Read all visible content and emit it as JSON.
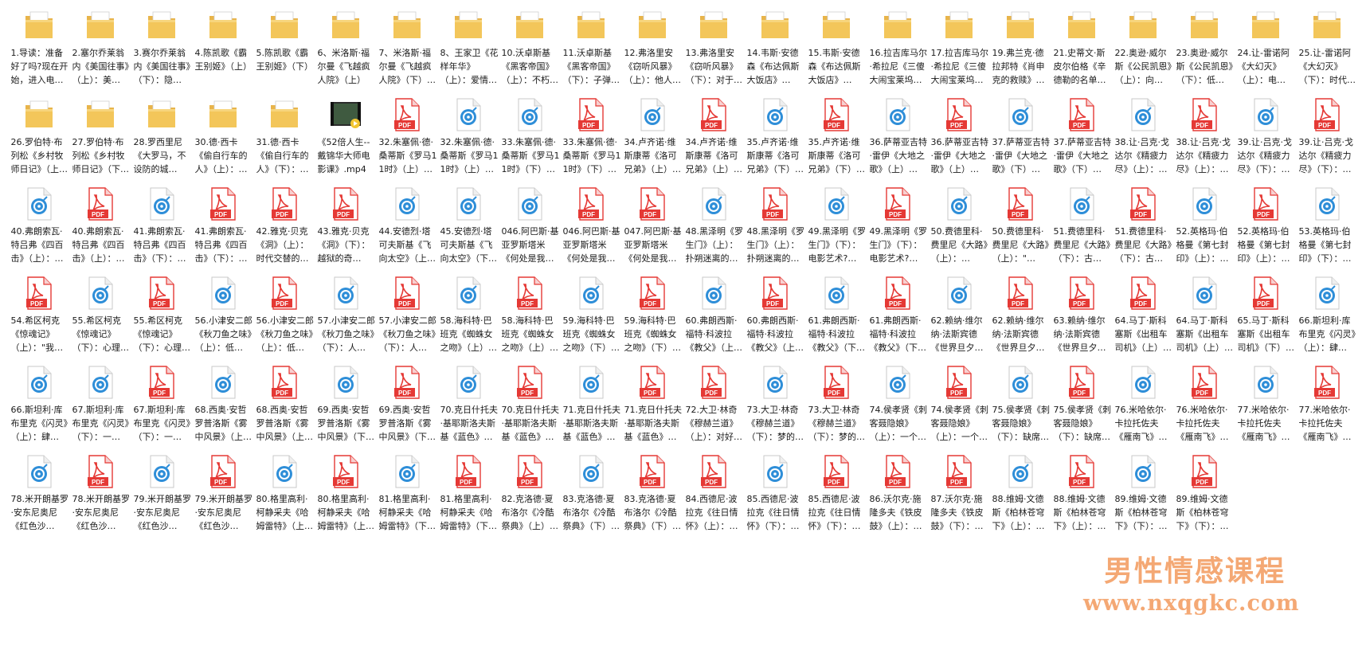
{
  "files": [
    {
      "type": "folder",
      "label": "1.导读：准备好了吗?现在开始，进入电影…"
    },
    {
      "type": "folder",
      "label": "2.塞尔乔莱翁内《美国往事》（上）：美…"
    },
    {
      "type": "folder",
      "label": "3.赛尔乔莱翁内《美国往事》（下）：隐…"
    },
    {
      "type": "folder",
      "label": "4.陈凯歌《霸王别姬》（上）"
    },
    {
      "type": "folder",
      "label": "5.陈凯歌《霸王别姬》（下）"
    },
    {
      "type": "folder",
      "label": "6、米洛斯·福尔曼《飞越疯人院》（上）"
    },
    {
      "type": "folder",
      "label": "7、米洛斯·福尔曼《飞越疯人院》（下）…"
    },
    {
      "type": "folder",
      "label": "8、王家卫《花样年华》（上）：爱情的…"
    },
    {
      "type": "folder",
      "label": "10.沃卓斯基《黑客帝国》（上）：不朽的…"
    },
    {
      "type": "folder",
      "label": "11.沃卓斯基《黑客帝国》（下）：子弹时间"
    },
    {
      "type": "folder",
      "label": "12.弗洛里安《窃听风暴》（上）：他人的…"
    },
    {
      "type": "folder",
      "label": "13.弗洛里安《窃听风暴》（下）：对于背…"
    },
    {
      "type": "folder",
      "label": "14.韦斯·安德森《布达佩斯大饭店》（上）…"
    },
    {
      "type": "folder",
      "label": "15.韦斯·安德森《布达佩斯大饭店》（下）…"
    },
    {
      "type": "folder",
      "label": "16.拉吉库马尔·希拉尼《三傻大闹宝莱坞…"
    },
    {
      "type": "folder",
      "label": "17.拉吉库马尔·希拉尼《三傻大闹宝莱坞…"
    },
    {
      "type": "folder",
      "label": "19.弗兰克·德拉邦特《肖申克的救赎》（下…"
    },
    {
      "type": "folder",
      "label": "21.史蒂文·斯皮尔伯格《辛德勒的名单》（…"
    },
    {
      "type": "folder",
      "label": "22.奥逊·威尔斯《公民凯恩》（上）：向…"
    },
    {
      "type": "folder",
      "label": "23.奥逊·威尔斯《公民凯恩》（下）：低…"
    },
    {
      "type": "folder",
      "label": "24.让-雷诺阿《大幻灭》（上）：电影，…"
    },
    {
      "type": "folder",
      "label": "25.让-雷诺阿《大幻灭》（下）：时代的…"
    },
    {
      "type": "folder",
      "label": "26.罗伯特·布列松《乡村牧师日记》（上…"
    },
    {
      "type": "folder",
      "label": "27.罗伯特·布列松《乡村牧师日记》（下…"
    },
    {
      "type": "folder",
      "label": "28.罗西里尼《大罗马，不设防的城市》…"
    },
    {
      "type": "folder",
      "label": "30.德·西卡《偷自行车的人》（上）：新…"
    },
    {
      "type": "folder",
      "label": "31.德·西卡《偷自行车的人》（下）：摄…"
    },
    {
      "type": "video",
      "label": "《52倍人生--戴锦华大师电影课》.mp4"
    },
    {
      "type": "pdf",
      "label": "32.朱塞佩·德·桑蒂斯《罗马11时》（上）…"
    },
    {
      "type": "audio",
      "label": "32.朱塞佩·德·桑蒂斯《罗马11时》（上）…"
    },
    {
      "type": "audio",
      "label": "33.朱塞佩·德·桑蒂斯《罗马11时》（下）…"
    },
    {
      "type": "pdf",
      "label": "33.朱塞佩·德·桑蒂斯《罗马11时》（下）…"
    },
    {
      "type": "audio",
      "label": "34.卢齐诺·维斯康蒂《洛可兄弟》（上）…"
    },
    {
      "type": "pdf",
      "label": "34.卢齐诺·维斯康蒂《洛可兄弟》（上）…"
    },
    {
      "type": "audio",
      "label": "35.卢齐诺·维斯康蒂《洛可兄弟》（下）…"
    },
    {
      "type": "pdf",
      "label": "35.卢齐诺·维斯康蒂《洛可兄弟》（下）…"
    },
    {
      "type": "audio",
      "label": "36.萨蒂亚吉特·雷伊《大地之歌》（上）…"
    },
    {
      "type": "pdf",
      "label": "36.萨蒂亚吉特·雷伊《大地之歌》（上）…"
    },
    {
      "type": "audio",
      "label": "37.萨蒂亚吉特·雷伊《大地之歌》（下）…"
    },
    {
      "type": "pdf",
      "label": "37.萨蒂亚吉特·雷伊《大地之歌》（下）…"
    },
    {
      "type": "audio",
      "label": "38.让·吕克·戈达尔《精疲力尽》（上）：断…"
    },
    {
      "type": "pdf",
      "label": "38.让·吕克·戈达尔《精疲力尽》（上）：断…"
    },
    {
      "type": "audio",
      "label": "39.让·吕克·戈达尔《精疲力尽》（下）：在…"
    },
    {
      "type": "pdf",
      "label": "39.让·吕克·戈达尔《精疲力尽》（下）：在…"
    },
    {
      "type": "audio",
      "label": "40.弗朗索瓦·特吕弗《四百击》（上）：…"
    },
    {
      "type": "pdf",
      "label": "40.弗朗索瓦·特吕弗《四百击》（上）：…"
    },
    {
      "type": "audio",
      "label": "41.弗朗索瓦·特吕弗《四百击》（下）：…"
    },
    {
      "type": "pdf",
      "label": "41.弗朗索瓦·特吕弗《四百击》（下）：…"
    },
    {
      "type": "pdf",
      "label": "42.雅克·贝克《洞》（上）：时代交替的电…"
    },
    {
      "type": "pdf",
      "label": "43.雅克·贝克《洞》（下）：越狱的奇观，…"
    },
    {
      "type": "audio",
      "label": "44.安德烈·塔可夫斯基《飞向太空》（上…"
    },
    {
      "type": "audio",
      "label": "45.安德烈·塔可夫斯基《飞向太空》（下…"
    },
    {
      "type": "audio",
      "label": "046.阿巴斯·基亚罗斯塔米《何处是我朋…"
    },
    {
      "type": "pdf",
      "label": "046.阿巴斯·基亚罗斯塔米《何处是我朋…"
    },
    {
      "type": "pdf",
      "label": "047.阿巴斯·基亚罗斯塔米《何处是我朋…"
    },
    {
      "type": "audio",
      "label": "48.黑泽明《罗生门》（上）：扑朔迷离的…"
    },
    {
      "type": "pdf",
      "label": "48.黑泽明《罗生门》（上）：扑朔迷离的…"
    },
    {
      "type": "audio",
      "label": "49.黑泽明《罗生门》（下）：电影艺术?…"
    },
    {
      "type": "pdf",
      "label": "49.黑泽明《罗生门》（下）：电影艺术?…"
    },
    {
      "type": "audio",
      "label": "50.费德里科·费里尼《大路》（上）：…"
    },
    {
      "type": "pdf",
      "label": "50.费德里科·费里尼《大路》（上）：\"…"
    },
    {
      "type": "audio",
      "label": "51.费德里科·费里尼《大路》（下）：古…"
    },
    {
      "type": "pdf",
      "label": "51.费德里科·费里尼《大路》（下）：古…"
    },
    {
      "type": "audio",
      "label": "52.英格玛·伯格曼《第七封印》（上）：信…"
    },
    {
      "type": "pdf",
      "label": "52.英格玛·伯格曼《第七封印》（上）：信…"
    },
    {
      "type": "audio",
      "label": "53.英格玛·伯格曼《第七封印》（下）：追…"
    },
    {
      "type": "pdf",
      "label": "54.希区柯克《惊魂记》（上）：\"我以…"
    },
    {
      "type": "audio",
      "label": "55.希区柯克《惊魂记》（下）：心理犯…"
    },
    {
      "type": "pdf",
      "label": "55.希区柯克《惊魂记》（下）：心理犯…"
    },
    {
      "type": "audio",
      "label": "56.小津安二郎《秋刀鱼之味》（上）：低…"
    },
    {
      "type": "pdf",
      "label": "56.小津安二郎《秋刀鱼之味》（上）：低…"
    },
    {
      "type": "audio",
      "label": "57.小津安二郎《秋刀鱼之味》（下）：人…"
    },
    {
      "type": "pdf",
      "label": "57.小津安二郎《秋刀鱼之味》（下）：人…"
    },
    {
      "type": "audio",
      "label": "58.海科特·巴班克《蜘蛛女之吻》（上）…"
    },
    {
      "type": "pdf",
      "label": "58.海科特·巴班克《蜘蛛女之吻》（上）…"
    },
    {
      "type": "audio",
      "label": "59.海科特·巴班克《蜘蛛女之吻》（下）…"
    },
    {
      "type": "pdf",
      "label": "59.海科特·巴班克《蜘蛛女之吻》（下）…"
    },
    {
      "type": "audio",
      "label": "60.弗朗西斯·福特·科波拉《教父》（上…"
    },
    {
      "type": "pdf",
      "label": "60.弗朗西斯·福特·科波拉《教父》（上…"
    },
    {
      "type": "audio",
      "label": "61.弗朗西斯·福特·科波拉《教父》（下…"
    },
    {
      "type": "pdf",
      "label": "61.弗朗西斯·福特·科波拉《教父》（下…"
    },
    {
      "type": "audio",
      "label": "62.赖纳·维尔纳·法斯宾德《世界旦夕之间…"
    },
    {
      "type": "pdf",
      "label": "62.赖纳·维尔纳·法斯宾德《世界旦夕之间…"
    },
    {
      "type": "pdf",
      "label": "63.赖纳·维尔纳·法斯宾德《世界旦夕之间…"
    },
    {
      "type": "pdf",
      "label": "64.马丁·斯科塞斯《出租车司机》（上）…"
    },
    {
      "type": "audio",
      "label": "64.马丁·斯科塞斯《出租车司机》（上）…"
    },
    {
      "type": "pdf",
      "label": "65.马丁·斯科塞斯《出租车司机》（下）…"
    },
    {
      "type": "audio",
      "label": "66.斯坦利·库布里克《闪灵》（上）：肆…"
    },
    {
      "type": "audio",
      "label": "66.斯坦利·库布里克《闪灵》（上）：肆…"
    },
    {
      "type": "audio",
      "label": "67.斯坦利·库布里克《闪灵》（下）：一…"
    },
    {
      "type": "pdf",
      "label": "67.斯坦利·库布里克《闪灵》（下）：一…"
    },
    {
      "type": "audio",
      "label": "68.西奥·安哲罗普洛斯《雾中风景》（上…"
    },
    {
      "type": "pdf",
      "label": "68.西奥·安哲罗普洛斯《雾中风景》（上…"
    },
    {
      "type": "audio",
      "label": "69.西奥·安哲罗普洛斯《雾中风景》（下…"
    },
    {
      "type": "pdf",
      "label": "69.西奥·安哲罗普洛斯《雾中风景》（下…"
    },
    {
      "type": "audio",
      "label": "70.克日什托夫·基耶斯洛夫斯基《蓝色》…"
    },
    {
      "type": "pdf",
      "label": "70.克日什托夫·基耶斯洛夫斯基《蓝色》…"
    },
    {
      "type": "audio",
      "label": "71.克日什托夫·基耶斯洛夫斯基《蓝色》…"
    },
    {
      "type": "pdf",
      "label": "71.克日什托夫·基耶斯洛夫斯基《蓝色》…"
    },
    {
      "type": "pdf",
      "label": "72.大卫·林奇《穆赫兰道》（上）：对好莱…"
    },
    {
      "type": "audio",
      "label": "73.大卫·林奇《穆赫兰道》（下）：梦的谜…"
    },
    {
      "type": "pdf",
      "label": "73.大卫·林奇《穆赫兰道》（下）：梦的谜…"
    },
    {
      "type": "audio",
      "label": "74.侯孝贤《刺客聂隐娘》（上）：一个人…"
    },
    {
      "type": "pdf",
      "label": "74.侯孝贤《刺客聂隐娘》（上）：一个人…"
    },
    {
      "type": "audio",
      "label": "75.侯孝贤《刺客聂隐娘》（下）：缺席的…"
    },
    {
      "type": "pdf",
      "label": "75.侯孝贤《刺客聂隐娘》（下）：缺席的…"
    },
    {
      "type": "audio",
      "label": "76.米哈依尔·卡拉托佐夫《雁南飞》（上…"
    },
    {
      "type": "pdf",
      "label": "76.米哈依尔·卡拉托佐夫《雁南飞》（上…"
    },
    {
      "type": "audio",
      "label": "77.米哈依尔·卡拉托佐夫《雁南飞》（下…"
    },
    {
      "type": "pdf",
      "label": "77.米哈依尔·卡拉托佐夫《雁南飞》（下…"
    },
    {
      "type": "audio",
      "label": "78.米开朗基罗·安东尼奥尼《红色沙漠》…"
    },
    {
      "type": "pdf",
      "label": "78.米开朗基罗·安东尼奥尼《红色沙漠》…"
    },
    {
      "type": "audio",
      "label": "79.米开朗基罗·安东尼奥尼《红色沙漠》…"
    },
    {
      "type": "pdf",
      "label": "79.米开朗基罗·安东尼奥尼《红色沙漠》…"
    },
    {
      "type": "audio",
      "label": "80.格里高利·柯静采夫《哈姆雷特》（上…"
    },
    {
      "type": "pdf",
      "label": "80.格里高利·柯静采夫《哈姆雷特》（上…"
    },
    {
      "type": "audio",
      "label": "81.格里高利·柯静采夫《哈姆雷特》（下…"
    },
    {
      "type": "pdf",
      "label": "81.格里高利·柯静采夫《哈姆雷特》（下…"
    },
    {
      "type": "pdf",
      "label": "82.克洛德·夏布洛尔《冷酷祭典》（上）…"
    },
    {
      "type": "audio",
      "label": "83.克洛德·夏布洛尔《冷酷祭典》（下）…"
    },
    {
      "type": "pdf",
      "label": "83.克洛德·夏布洛尔《冷酷祭典》（下）…"
    },
    {
      "type": "pdf",
      "label": "84.西德尼·波拉克《往日情怀》（上）：跨…"
    },
    {
      "type": "audio",
      "label": "85.西德尼·波拉克《往日情怀》（下）：另…"
    },
    {
      "type": "pdf",
      "label": "85.西德尼·波拉克《往日情怀》（下）：另…"
    },
    {
      "type": "pdf",
      "label": "86.沃尔克·施隆多夫《铁皮鼓》（上）：畸…"
    },
    {
      "type": "pdf",
      "label": "87.沃尔克·施隆多夫《铁皮鼓》（下）：褪…"
    },
    {
      "type": "audio",
      "label": "88.维姆·文德斯《柏林苍穹下》（上）：一…"
    },
    {
      "type": "pdf",
      "label": "88.维姆·文德斯《柏林苍穹下》（上）：一…"
    },
    {
      "type": "audio",
      "label": "89.维姆·文德斯《柏林苍穹下》（下）：…"
    },
    {
      "type": "pdf",
      "label": "89.维姆·文德斯《柏林苍穹下》（下）：…"
    }
  ],
  "icons": {
    "folder": "folder-icon",
    "pdf": "pdf-file-icon",
    "audio": "audio-file-icon",
    "video": "video-file-icon"
  },
  "icon_text": {
    "pdf": "PDF"
  },
  "colors": {
    "folder": "#f3c65a",
    "pdf": "#e53935",
    "audio": "#2e8ed8",
    "watermark": "#f39a5c"
  },
  "watermark": {
    "line1": "男性情感课程",
    "line2": "www.nxqgkc.com"
  }
}
